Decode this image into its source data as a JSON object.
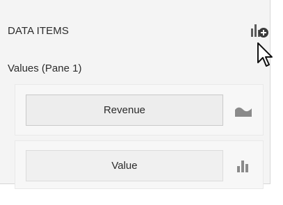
{
  "panel": {
    "section_title": "DATA ITEMS",
    "add_icon": "add-series-icon",
    "pane_label": "Values (Pane 1)",
    "items": [
      {
        "label": "Revenue",
        "series_icon": "area-series-icon"
      },
      {
        "label": "Value",
        "series_icon": "bar-series-icon"
      }
    ]
  },
  "colors": {
    "panel_bg": "#f4f4f4",
    "icon_gray": "#8a8a8a",
    "icon_dark": "#3a3a3a"
  }
}
